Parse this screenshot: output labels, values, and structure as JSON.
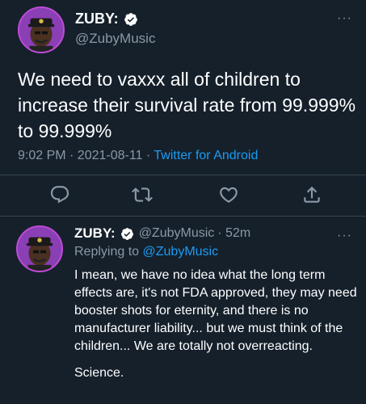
{
  "main_tweet": {
    "display_name": "ZUBY:",
    "handle": "@ZubyMusic",
    "more": "···",
    "text": "We need to vaxxx all of children to increase their survival rate from 99.999% to 99.999%",
    "timestamp": "9:02 PM · 2021-08-11 · ",
    "source": "Twitter for Android",
    "actions": [
      "reply-icon",
      "retweet-icon",
      "like-icon",
      "share-icon"
    ]
  },
  "reply_tweet": {
    "display_name": "ZUBY:",
    "handle": "@ZubyMusic",
    "age": "· 52m",
    "more": "···",
    "replying_prefix": "Replying to ",
    "replying_to": "@ZubyMusic",
    "text_paragraph_1": "I mean, we have no idea what the long term effects are, it's not FDA approved, they may need booster shots for eternity, and there is no manufacturer liability... but we must think of the children... We are totally not overreacting.",
    "text_paragraph_2": "Science."
  },
  "colors": {
    "background": "#15202b",
    "text": "#ffffff",
    "secondary": "#8b98a5",
    "link": "#1d9bf0",
    "verified": "#ffffff",
    "avatar_ring": "#c04bd8"
  }
}
